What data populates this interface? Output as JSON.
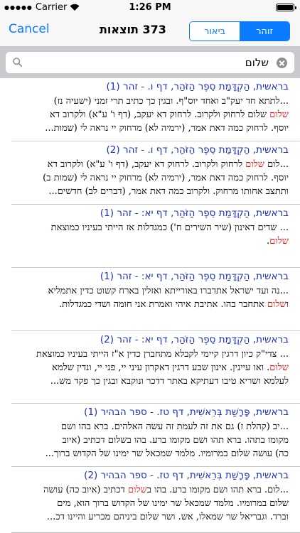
{
  "status": {
    "carrier": "Carrier",
    "time": "1:26 PM"
  },
  "nav": {
    "cancel": "Cancel",
    "title": "373 תוצאות",
    "segments": [
      "ביאור",
      "זוהר"
    ],
    "selected_segment": "זוהר",
    "accent": "#0a7aff"
  },
  "search": {
    "value": "שלום",
    "placeholder": ""
  },
  "colors": {
    "highlight": "#e01010",
    "title": "#1a2fbf"
  },
  "results": [
    {
      "title": "בראשית, הַקְדָּמַת סֵפֶר הַזֹּהַר, דף ו. - זהר (1)",
      "lines": [
        [
          {
            "t": "...לתתא חד יעק\"ב ואחד יוס\"ף. ובגין כך כתיב תרי זמני (ישעיה נז)"
          }
        ],
        [
          {
            "t": "שלום",
            "h": true
          },
          {
            "t": " שלום לרחוק ולקרוב. לרחוק דא יעקב, (דף ו' ע\"א) ולקרוב דא"
          }
        ],
        [
          {
            "t": "יוסף. לרחוק כמה דאת אמר, (ירמיה לא) מרחוק יי נראה לי (שמות..."
          }
        ]
      ]
    },
    {
      "title": "בראשית, הַקְדָּמַת סֵפֶר הַזֹּהַר, דף ו. - זהר (2)",
      "lines": [
        [
          {
            "t": "...לום "
          },
          {
            "t": "שלום",
            "h": true
          },
          {
            "t": " לרחוק ולקרוב. לרחוק דא יעקב, (דף ו' ע\"א) ולקרוב דא"
          }
        ],
        [
          {
            "t": "יוסף. לרחוק כמה דאת אמר, (ירמיה לא) מרחוק יי נראה לי (שמות ב)"
          }
        ],
        [
          {
            "t": "ותתצב אחותו מרחוק. ולקרוב כמה דאת אמר, (דברים לב) חדשים..."
          }
        ]
      ]
    },
    {
      "title": "בראשית, הַקְדָּמַת סֵפֶר הַזֹּהַר, דף יא: - זהר (1)",
      "lines": [
        [
          {
            "t": "... שדים דאינון (שיר השירים ח') כמגדלות אז הייתי בעיניו כמוצאת"
          }
        ],
        [
          {
            "t": "שלום",
            "h": true
          },
          {
            "t": "."
          }
        ]
      ]
    },
    {
      "title": "בראשית, הַקְדָּמַת סֵפֶר הַזֹּהַר, דף יא: - זהר (1)",
      "lines": [
        [
          {
            "t": "...נה ועד ישראל אתדברו באורייתא ואזלין בארח קשוט כדין אתמליא"
          }
        ],
        [
          {
            "t": "ו"
          },
          {
            "t": "שלום",
            "h": true
          },
          {
            "t": " אתחבר בהו. אתיבת איהי ואמרת אני חומה ושדי כמגדלות."
          }
        ]
      ]
    },
    {
      "title": "בראשית, הַקְדָּמַת סֵפֶר הַזֹּהַר, דף יא: - זהר (2)",
      "lines": [
        [
          {
            "t": "... צדי\"ק כיון דרגין קיימי לקבלא מתחברן כדין א\"ז הייתי בעיניו כמוצאת"
          }
        ],
        [
          {
            "t": "שלום",
            "h": true
          },
          {
            "t": ". ואו עיינין. אינון שבע דרגין דאקרון עיני יי, פני יי, ונדין שלמא"
          }
        ],
        [
          {
            "t": "לעלמא ושריא טיבו דעתיקא באתר דדכר ונוקבא ובגין כך פקד מש..."
          }
        ]
      ]
    },
    {
      "title": "בראשית, פָּרָשַׁת בְּרֵאשִׁית, דף טז. - ספר הבהיר (1)",
      "lines": [
        [
          {
            "t": "...יב (קהלת ז) גם את זה לעמת זה עשה האלהים. ברא בהו ושם"
          }
        ],
        [
          {
            "t": "מקומו בתהו. ברא תהו ושם מקומו ברע. בהו בשלום דכתיב (איוב"
          }
        ],
        [
          {
            "t": "כה) עושה שלום במרומיו. מלמד שמכאל שר ימינו של הקדוש ברוך..."
          }
        ]
      ]
    },
    {
      "title": "בראשית, פָּרָשַׁת בְּרֵאשִׁית, דף טז. - ספר הבהיר (2)",
      "lines": [
        [
          {
            "t": "...לום. ברא תהו ושם מקומו ברע. בהו ב"
          },
          {
            "t": "שלום",
            "h": true
          },
          {
            "t": " דכתיב (איוב כה) עושה"
          }
        ],
        [
          {
            "t": "שלום במרומיו. מלמד שמכאל שר ימינו של הקדוש ברוך הוא, מים"
          }
        ],
        [
          {
            "t": "וברד. וגבריאל שר שמאלו, אש. ושר שלום ביניהם מכריע והיינו דכ..."
          }
        ]
      ]
    }
  ]
}
